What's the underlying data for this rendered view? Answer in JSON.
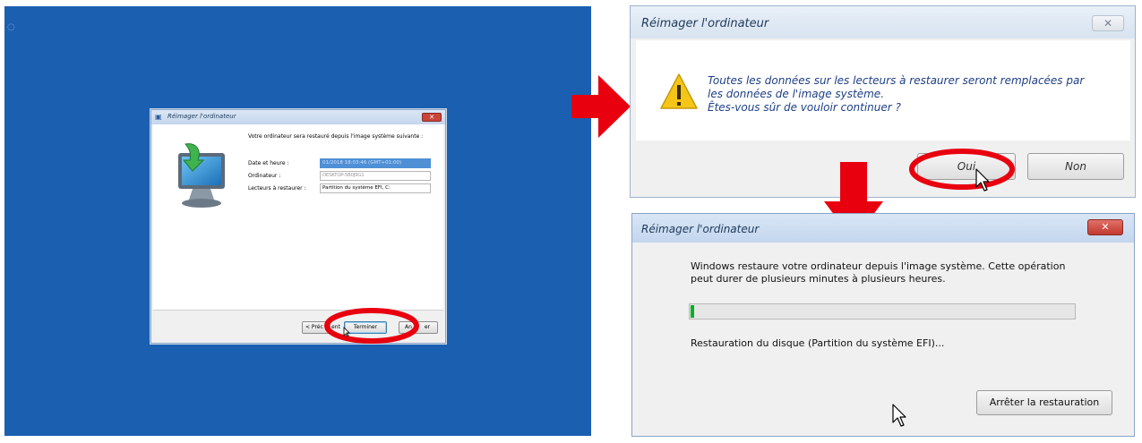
{
  "dialog_small": {
    "title": "Réimager l'ordinateur",
    "intro": "Votre ordinateur sera restauré depuis l'image système suivante :",
    "fields": [
      {
        "label": "Date et heure :",
        "value": "01/2018 18:03:46 (GMT+01:00)"
      },
      {
        "label": "Ordinateur :",
        "value": "DESKTOP-5B0J9G1"
      },
      {
        "label": "Lecteurs à restaurer :",
        "value": "Partition du système EFI, C:"
      }
    ],
    "buttons": {
      "previous": "< Préc",
      "previous_tail": "ent",
      "finish": "Terminer",
      "cancel_head": "An",
      "cancel_tail": "er"
    }
  },
  "dialog_confirm": {
    "title": "Réimager l'ordinateur",
    "close_glyph": "✕",
    "message_lines": [
      "Toutes les données sur les lecteurs à restaurer seront remplacées par",
      "les données de l'image système.",
      "Êtes-vous sûr de vouloir continuer ?"
    ],
    "yes": "Oui",
    "no": "Non"
  },
  "dialog_progress": {
    "title": "Réimager l'ordinateur",
    "close_glyph": "✕",
    "message_lines": [
      "Windows restaure votre ordinateur depuis l'image système. Cette opération",
      "peut durer de plusieurs minutes à plusieurs heures."
    ],
    "progress_fraction": 0.01,
    "status": "Restauration du disque (Partition du système EFI)...",
    "stop": "Arrêter la restauration"
  },
  "colors": {
    "desktop": "#1b5fb0",
    "highlight": "#e8000f",
    "progress": "#06b025"
  },
  "icons": {
    "warning": "warning-icon",
    "restore": "restore-monitor-icon",
    "arrow": "red-arrow-icon"
  }
}
